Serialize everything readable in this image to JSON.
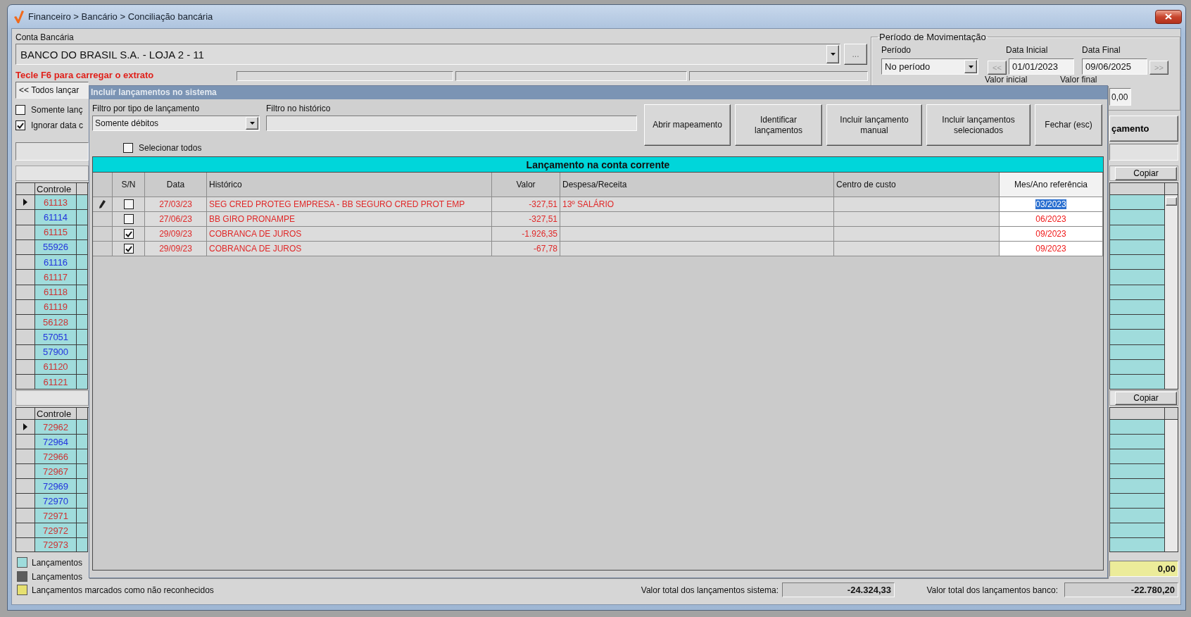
{
  "window": {
    "title": "Financeiro > Bancário > Conciliação bancária"
  },
  "account": {
    "label": "Conta Bancária",
    "value": "BANCO DO BRASIL S.A. - LOJA 2 - 11",
    "more_button": "..."
  },
  "hint": "Tecle F6 para carregar o extrato",
  "period": {
    "title": "Período de Movimentação",
    "period_label": "Período",
    "period_value": "No período",
    "start_label": "Data Inicial",
    "start_value": "01/01/2023",
    "end_label": "Data Final",
    "end_value": "09/06/2025",
    "prev_button": "<<",
    "next_button": ">>",
    "min_value_label": "Valor inicial",
    "max_value_label": "Valor final",
    "max_value": "0,00"
  },
  "list_filter": "<< Todos lançar",
  "options": [
    {
      "label": "Somente lanç",
      "checked": false
    },
    {
      "label": "Ignorar data c",
      "checked": true
    }
  ],
  "action_button": "çamento",
  "upper_grid": {
    "copy_button": "Copiar",
    "column": "Controle",
    "rows": [
      {
        "value": "61113",
        "color": "#cc3333",
        "selected": true
      },
      {
        "value": "61114",
        "color": "#2233dd",
        "selected": false
      },
      {
        "value": "61115",
        "color": "#cc3333",
        "selected": false
      },
      {
        "value": "55926",
        "color": "#2233dd",
        "selected": false
      },
      {
        "value": "61116",
        "color": "#2233dd",
        "selected": false
      },
      {
        "value": "61117",
        "color": "#cc3333",
        "selected": false
      },
      {
        "value": "61118",
        "color": "#cc3333",
        "selected": false
      },
      {
        "value": "61119",
        "color": "#cc3333",
        "selected": false
      },
      {
        "value": "56128",
        "color": "#cc3333",
        "selected": false
      },
      {
        "value": "57051",
        "color": "#2233dd",
        "selected": false
      },
      {
        "value": "57900",
        "color": "#2233dd",
        "selected": false
      },
      {
        "value": "61120",
        "color": "#cc3333",
        "selected": false
      },
      {
        "value": "61121",
        "color": "#cc3333",
        "selected": false
      }
    ]
  },
  "lower_grid": {
    "copy_button": "Copiar",
    "column": "Controle",
    "rows": [
      {
        "value": "72962",
        "color": "#cc3333",
        "selected": true
      },
      {
        "value": "72964",
        "color": "#2233dd",
        "selected": false
      },
      {
        "value": "72966",
        "color": "#cc3333",
        "selected": false
      },
      {
        "value": "72967",
        "color": "#cc3333",
        "selected": false
      },
      {
        "value": "72969",
        "color": "#2233dd",
        "selected": false
      },
      {
        "value": "72970",
        "color": "#2233dd",
        "selected": false
      },
      {
        "value": "72971",
        "color": "#cc3333",
        "selected": false
      },
      {
        "value": "72972",
        "color": "#cc3333",
        "selected": false
      },
      {
        "value": "72973",
        "color": "#cc3333",
        "selected": false
      }
    ]
  },
  "legend": [
    {
      "label": "Lançamentos",
      "color": "#9edcdc"
    },
    {
      "label": "Lançamentos",
      "color": "#5c5c5c"
    },
    {
      "label": "Lançamentos marcados como não reconhecidos",
      "color": "#e6e070"
    }
  ],
  "unrecognized_total": "0,00",
  "totals": [
    {
      "label": "Valor total dos lançamentos sistema:",
      "value": "-24.324,33"
    },
    {
      "label": "Valor total dos lançamentos banco:",
      "value": "-22.780,20"
    }
  ],
  "dialog": {
    "title": "Incluir lançamentos no sistema",
    "type_filter": {
      "label": "Filtro por tipo de lançamento",
      "value": "Somente débitos"
    },
    "history_filter": {
      "label": "Filtro no histórico"
    },
    "buttons": [
      "Abrir mapeamento",
      "Identificar lançamentos",
      "Incluir lançamento manual",
      "Incluir lançamentos selecionados",
      "Fechar (esc)"
    ],
    "select_all": {
      "label": "Selecionar todos",
      "checked": false
    },
    "table": {
      "title": "Lançamento na conta corrente",
      "columns": [
        "S/N",
        "Data",
        "Histórico",
        "Valor",
        "Despesa/Receita",
        "Centro de custo",
        "Mes/Ano referência"
      ],
      "rows": [
        {
          "selected": true,
          "checked": false,
          "date": "27/03/23",
          "history": "SEG CRED PROTEG EMPRESA - BB SEGURO CRED PROT EMP",
          "value": "-327,51",
          "category": "13º SALÁRIO",
          "reference": "03/2023"
        },
        {
          "selected": false,
          "checked": false,
          "date": "27/06/23",
          "history": "BB GIRO PRONAMPE",
          "value": "-327,51",
          "reference": "06/2023"
        },
        {
          "selected": false,
          "checked": true,
          "date": "29/09/23",
          "history": "COBRANCA DE JUROS",
          "value": "-1.926,35",
          "reference": "09/2023"
        },
        {
          "selected": false,
          "checked": true,
          "date": "29/09/23",
          "history": "COBRANCA DE JUROS",
          "value": "-67,78",
          "reference": "09/2023"
        }
      ]
    }
  }
}
